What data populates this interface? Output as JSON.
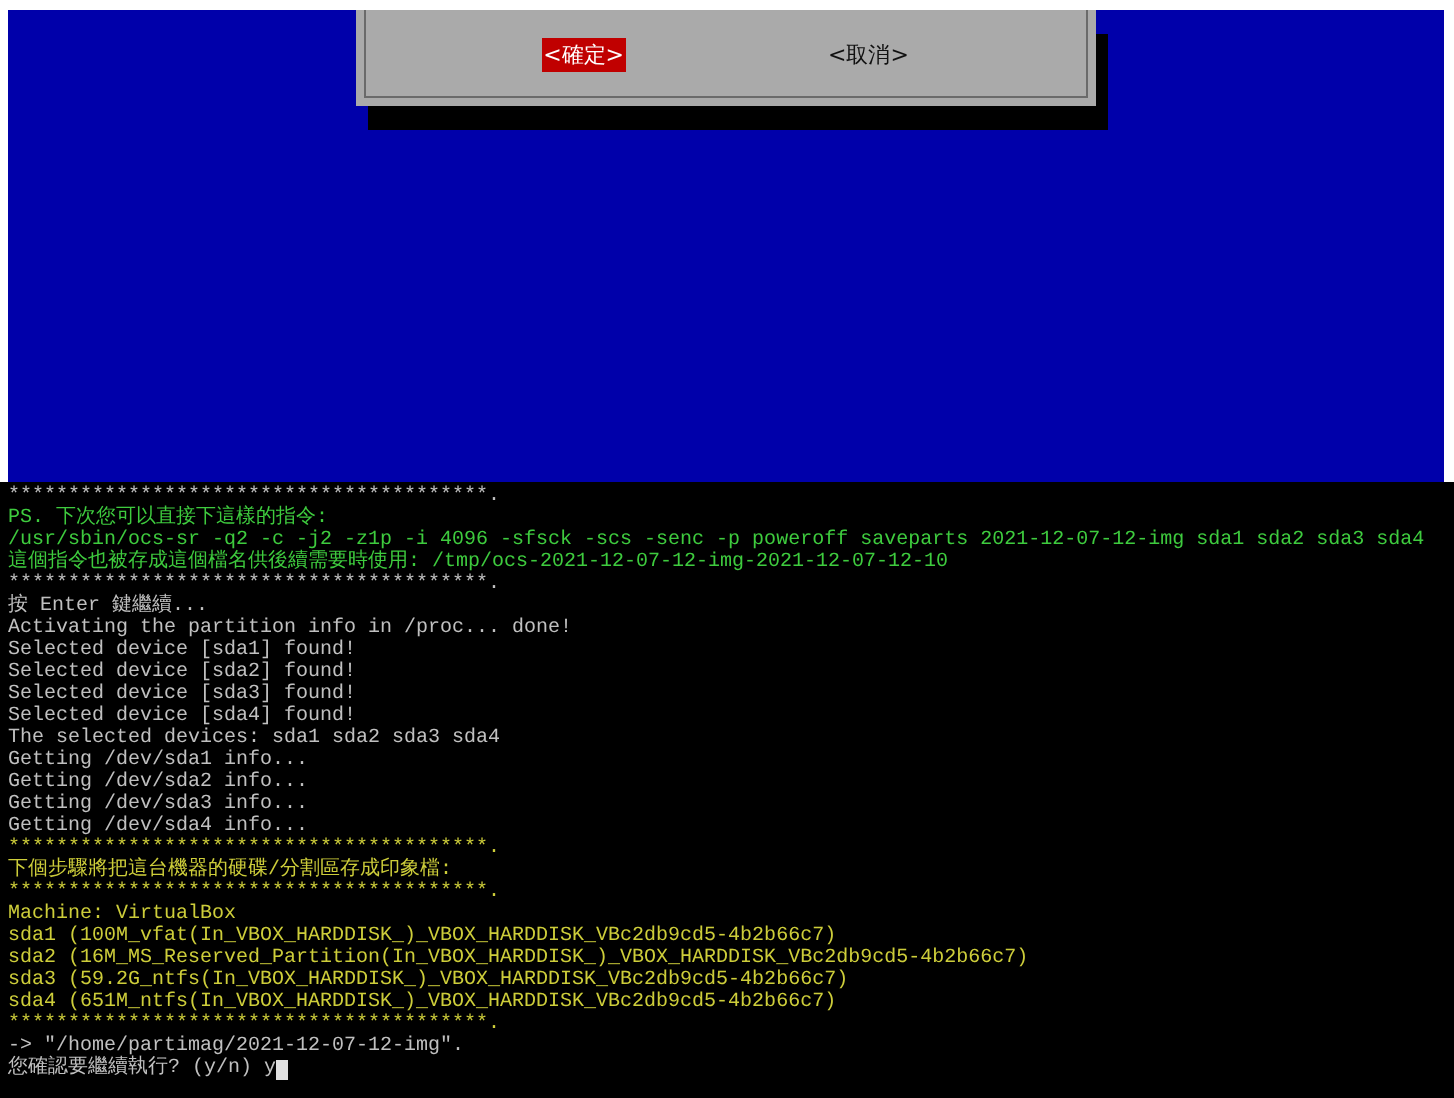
{
  "dialog": {
    "buttons": [
      {
        "label": "<確定>",
        "selected": true
      },
      {
        "label": "<取消>",
        "selected": false
      }
    ]
  },
  "terminal": {
    "lines": [
      {
        "kind": "plain",
        "text": "****************************************."
      },
      {
        "kind": "green",
        "text": "PS. 下次您可以直接下這樣的指令:"
      },
      {
        "kind": "green",
        "text": "/usr/sbin/ocs-sr -q2 -c -j2 -z1p -i 4096 -sfsck -scs -senc -p poweroff saveparts 2021-12-07-12-img sda1 sda2 sda3 sda4"
      },
      {
        "kind": "green",
        "text": "這個指令也被存成這個檔名供後續需要時使用: /tmp/ocs-2021-12-07-12-img-2021-12-07-12-10"
      },
      {
        "kind": "plain",
        "text": "****************************************."
      },
      {
        "kind": "plain",
        "text": "按 Enter 鍵繼續..."
      },
      {
        "kind": "plain",
        "text": "Activating the partition info in /proc... done!"
      },
      {
        "kind": "plain",
        "text": "Selected device [sda1] found!"
      },
      {
        "kind": "plain",
        "text": "Selected device [sda2] found!"
      },
      {
        "kind": "plain",
        "text": "Selected device [sda3] found!"
      },
      {
        "kind": "plain",
        "text": "Selected device [sda4] found!"
      },
      {
        "kind": "plain",
        "text": "The selected devices: sda1 sda2 sda3 sda4"
      },
      {
        "kind": "plain",
        "text": "Getting /dev/sda1 info..."
      },
      {
        "kind": "plain",
        "text": "Getting /dev/sda2 info..."
      },
      {
        "kind": "plain",
        "text": "Getting /dev/sda3 info..."
      },
      {
        "kind": "plain",
        "text": "Getting /dev/sda4 info..."
      },
      {
        "kind": "yellow",
        "text": "****************************************."
      },
      {
        "kind": "yellow",
        "text": "下個步驟將把這台機器的硬碟/分割區存成印象檔:"
      },
      {
        "kind": "yellow",
        "text": "****************************************."
      },
      {
        "kind": "yellow",
        "text": "Machine: VirtualBox"
      },
      {
        "kind": "yellow",
        "text": "sda1 (100M_vfat(In_VBOX_HARDDISK_)_VBOX_HARDDISK_VBc2db9cd5-4b2b66c7)"
      },
      {
        "kind": "yellow",
        "text": "sda2 (16M_MS_Reserved_Partition(In_VBOX_HARDDISK_)_VBOX_HARDDISK_VBc2db9cd5-4b2b66c7)"
      },
      {
        "kind": "yellow",
        "text": "sda3 (59.2G_ntfs(In_VBOX_HARDDISK_)_VBOX_HARDDISK_VBc2db9cd5-4b2b66c7)"
      },
      {
        "kind": "yellow",
        "text": "sda4 (651M_ntfs(In_VBOX_HARDDISK_)_VBOX_HARDDISK_VBc2db9cd5-4b2b66c7)"
      },
      {
        "kind": "yellow",
        "text": "****************************************."
      },
      {
        "kind": "plain",
        "text": "-> \"/home/partimag/2021-12-07-12-img\"."
      }
    ],
    "prompt": "您確認要繼續執行? (y/n) y"
  }
}
